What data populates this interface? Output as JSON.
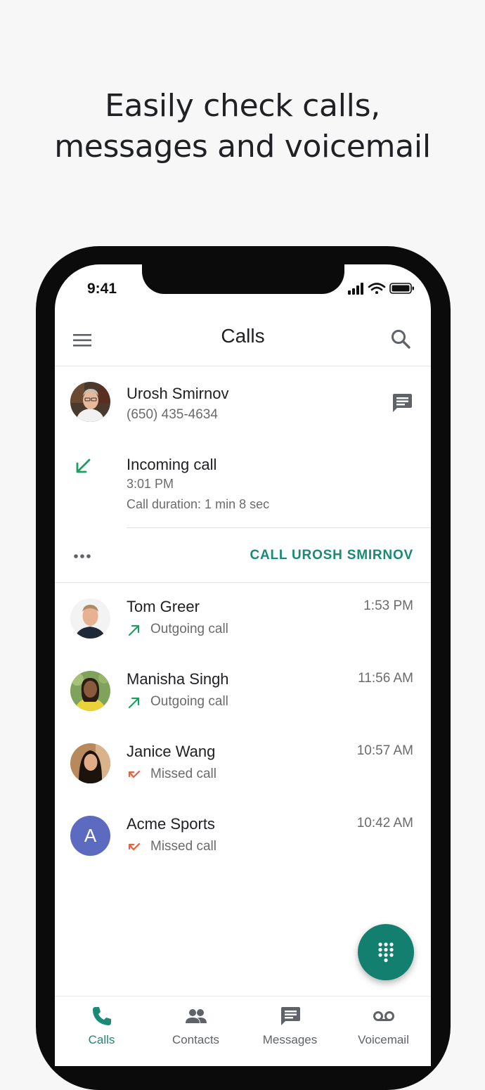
{
  "headline": {
    "line1": "Easily check calls,",
    "line2": "messages and voicemail"
  },
  "status_bar": {
    "time": "9:41"
  },
  "app_bar": {
    "title": "Calls"
  },
  "expanded_call": {
    "contact_name": "Urosh Smirnov",
    "phone": "(650) 435-4634",
    "call_type": "Incoming call",
    "time": "3:01 PM",
    "duration": "Call duration: 1 min 8 sec",
    "action_label": "CALL UROSH SMIRNOV"
  },
  "calls": [
    {
      "name": "Tom Greer",
      "type": "Outgoing call",
      "time": "1:53 PM",
      "direction": "outgoing"
    },
    {
      "name": "Manisha Singh",
      "type": "Outgoing call",
      "time": "11:56 AM",
      "direction": "outgoing"
    },
    {
      "name": "Janice Wang",
      "type": "Missed call",
      "time": "10:57 AM",
      "direction": "missed"
    },
    {
      "name": "Acme Sports",
      "type": "Missed call",
      "time": "10:42 AM",
      "direction": "missed",
      "initial": "A"
    }
  ],
  "bottom_nav": [
    {
      "label": "Calls",
      "icon": "phone-icon",
      "active": true
    },
    {
      "label": "Contacts",
      "icon": "people-icon",
      "active": false
    },
    {
      "label": "Messages",
      "icon": "message-icon",
      "active": false
    },
    {
      "label": "Voicemail",
      "icon": "voicemail-icon",
      "active": false
    }
  ],
  "colors": {
    "accent": "#1a8a74",
    "fab": "#13806f",
    "incoming": "#1e9e60",
    "outgoing": "#1e9e60",
    "missed": "#e8603c",
    "avatar_initial_bg": "#5c6bc0"
  }
}
